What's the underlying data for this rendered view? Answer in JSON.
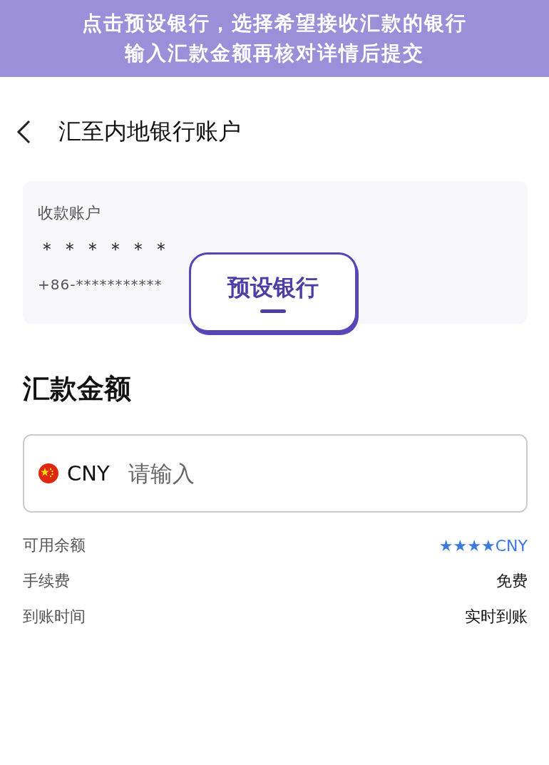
{
  "banner": {
    "lines": [
      "点击预设银行，选择希望接收汇款的银行",
      "输入汇款金额再核对详情后提交"
    ]
  },
  "header": {
    "title": "汇至内地银行账户"
  },
  "account": {
    "label": "收款账户",
    "name": "＊＊＊＊＊＊",
    "phone": "+86-***********"
  },
  "callout": {
    "label": "预设银行"
  },
  "amount": {
    "title": "汇款金额",
    "currency": "CNY",
    "placeholder": "请输入"
  },
  "details": [
    {
      "label": "可用余额",
      "value": "★★★★CNY",
      "kind": "balance"
    },
    {
      "label": "手续费",
      "value": "免费",
      "kind": "plain"
    },
    {
      "label": "到账时间",
      "value": "实时到账",
      "kind": "plain"
    }
  ]
}
